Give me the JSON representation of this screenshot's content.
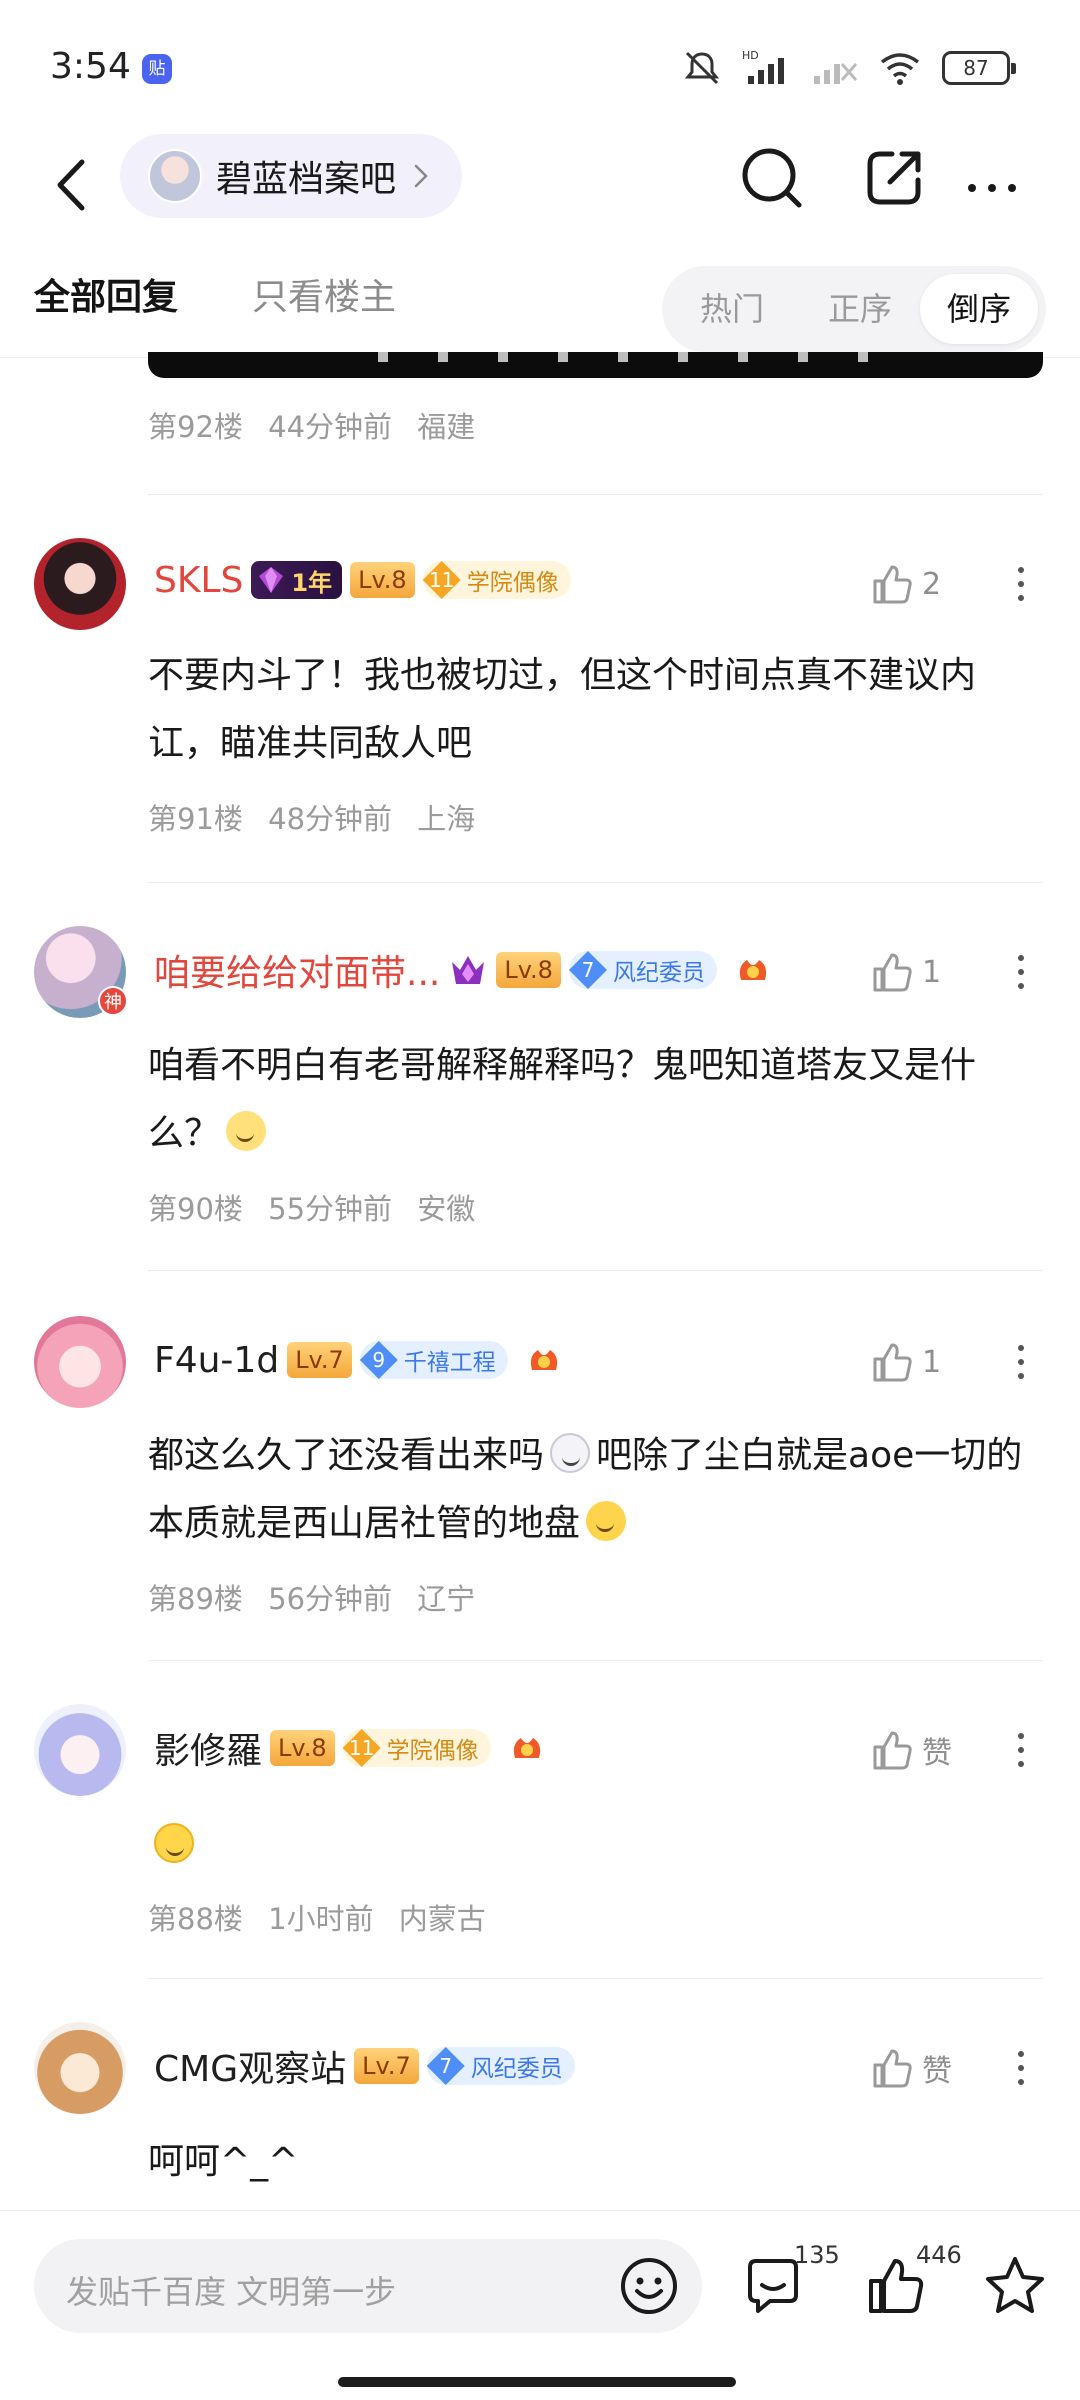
{
  "status_bar": {
    "time": "3:54",
    "app_icon": "贴",
    "battery": "87"
  },
  "nav": {
    "forum_name": "碧蓝档案吧"
  },
  "tabs": {
    "all_replies": "全部回复",
    "owner_only": "只看楼主"
  },
  "sort": {
    "hot": "热门",
    "asc": "正序",
    "desc": "倒序"
  },
  "top_meta": {
    "floor": "第92楼",
    "time": "44分钟前",
    "location": "福建"
  },
  "replies": [
    {
      "username": "SKLS",
      "tenure": "1年",
      "level": "Lv.8",
      "title_num": "11",
      "title": "学院偶像",
      "likes": "2",
      "text": "不要内斗了！我也被切过，但这个时间点真不建议内讧，瞄准共同敌人吧",
      "floor": "第91楼",
      "time": "48分钟前",
      "location": "上海"
    },
    {
      "username": "咱要给给对面带...",
      "avatar_badge": "神",
      "level": "Lv.8",
      "title_num": "7",
      "title": "风纪委员",
      "likes": "1",
      "text": "咱看不明白有老哥解释解释吗？鬼吧知道塔友又是什么？",
      "floor": "第90楼",
      "time": "55分钟前",
      "location": "安徽"
    },
    {
      "username": "F4u-1d",
      "level": "Lv.7",
      "title_num": "9",
      "title": "千禧工程",
      "likes": "1",
      "text_part1": "都这么久了还没看出来吗",
      "text_part2": "吧除了尘白就是aoe一切的 本质就是西山居社管的地盘",
      "floor": "第89楼",
      "time": "56分钟前",
      "location": "辽宁"
    },
    {
      "username": "影修羅",
      "level": "Lv.8",
      "title_num": "11",
      "title": "学院偶像",
      "likes": "赞",
      "floor": "第88楼",
      "time": "1小时前",
      "location": "内蒙古"
    },
    {
      "username": "CMG观察站",
      "level": "Lv.7",
      "title_num": "7",
      "title": "风纪委员",
      "likes": "赞",
      "text": "呵呵^_^"
    }
  ],
  "bottom_bar": {
    "compose_placeholder": "发贴千百度 文明第一步",
    "comments": "135",
    "likes": "446"
  },
  "colors": {
    "accent_red": "#e2463c",
    "level_gold": "#f4a73b",
    "title_blue": "#4f8df7",
    "title_gold": "#f5a623"
  },
  "icons": [
    "back-icon",
    "chevron-right-icon",
    "search-icon",
    "share-icon",
    "more-icon",
    "like-icon",
    "emoji-icon",
    "comment-icon",
    "star-icon"
  ]
}
